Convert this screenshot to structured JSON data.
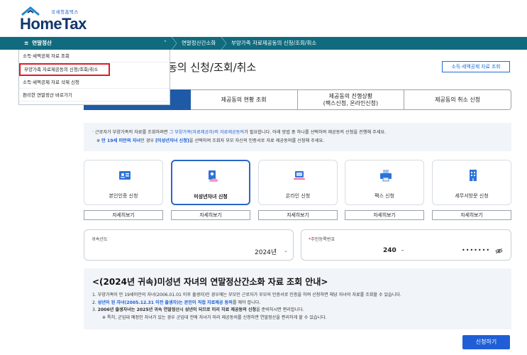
{
  "header": {
    "logo_sub": "국세청홈택스",
    "logo_main": "HomeTax"
  },
  "navbar": {
    "menu_label": "연말정산",
    "crumbs": [
      "연말정산간소화",
      "부양가족 자료제공동의 신청/조회/취소"
    ]
  },
  "dropdown": {
    "items": [
      "소득·세액공제 자료 조회",
      "부양가족 자료제공동의 신청/조회/취소",
      "소득·세액공제 자료 삭제 신청",
      "편리한 연말정산 바로가기"
    ]
  },
  "page": {
    "title": "동의 신청/조회/취소",
    "tag_button": "소득·세액공제 자료 조회"
  },
  "tabs": [
    {
      "line1": "",
      "line2": ""
    },
    {
      "line1": "제공동의 현황 조회",
      "line2": ""
    },
    {
      "line1": "제공동의 진행상황",
      "line2": "(팩스신청, 온라인신청)"
    },
    {
      "line1": "제공동의 취소 신청",
      "line2": ""
    }
  ],
  "notice": {
    "line1_a": "· 근로자가 부양가족의 자료를 조회하려면 ",
    "line1_b": "그 부양가족(자료제공자)의 자료제공동의",
    "line1_c": "가 필요합니다. 아래 방법 중 하나를 선택하여 제공동의 신청을 진행해 주세요.",
    "line2_a": "※ ",
    "line2_b": "만 19세 미만의 자녀",
    "line2_c": "인 경우 ",
    "line2_d": "[미성년자녀 신청]",
    "line2_e": "을 선택하여 조회자 부모 자신의 인증서로 자료 제공동의를 신청해 주세요."
  },
  "cards": [
    {
      "label": "본인인증 신청",
      "detail": "자세히보기",
      "icon": "id-card-icon"
    },
    {
      "label": "미성년자녀 신청",
      "detail": "자세히보기",
      "icon": "child-consent-icon"
    },
    {
      "label": "온라인 신청",
      "detail": "자세히보기",
      "icon": "laptop-icon"
    },
    {
      "label": "팩스 신청",
      "detail": "자세히보기",
      "icon": "fax-icon"
    },
    {
      "label": "세무서방문 신청",
      "detail": "자세히보기",
      "icon": "building-icon"
    }
  ],
  "form": {
    "year_label": "귀속년도",
    "year_value": "2024년",
    "rrn_required": "*",
    "rrn_label": "주민등록번호",
    "rrn_front": "240",
    "rrn_dash": "-",
    "rrn_back": "•••••••"
  },
  "guide": {
    "title": "<(2024년 귀속)미성년 자녀의 연말정산간소화 자료 조회 안내>",
    "line1": "1. 부양가족이 만 19세미만의 자녀(2006.01.01 이후 출생자)인 경우에는 부모인 근로자가 부모의 인증서로 인증을 하여 신청하면 해당 자녀의 자료를 조회할 수 있습니다.",
    "line2_num": "2. ",
    "line2_a": "성년이 된 자녀(2005.12.31 이전 출생자)는 본인이 직접 자료제공 동의",
    "line2_b": "를 해야 합니다.",
    "line3_num": "3. ",
    "line3_a": "2006년 출생자녀는 2025년 귀속 연말정산시 성년이 되므로 미리 자료 제공동의 신청",
    "line3_b": "을 준비하시면 편리합니다.",
    "line4": "※ 특히, 군입대 예정인 자녀가 있는 경우 군입대 전에 자녀가 미리 제공동의를 신청하면 연말정산을 편리하게 할 수 있습니다."
  },
  "apply_button": "신청하기",
  "colors": {
    "nav": "#0f6b7d",
    "accent": "#1f5ed6",
    "highlight_border": "#e0192a",
    "tab_active": "#1f5aa6"
  }
}
